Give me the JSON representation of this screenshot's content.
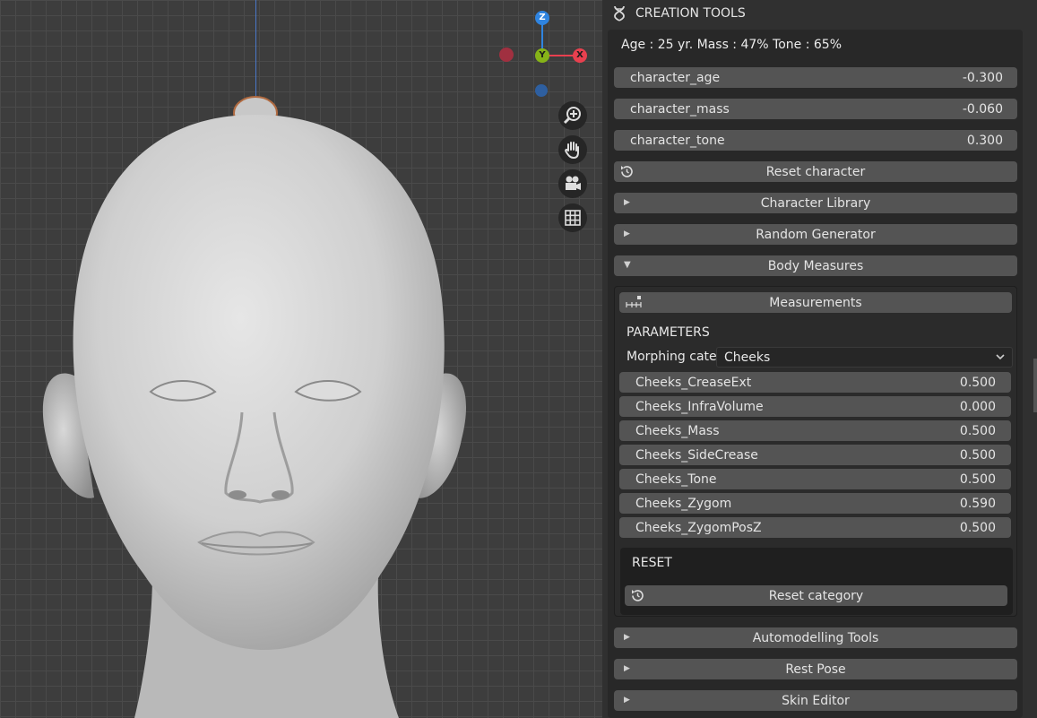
{
  "panel": {
    "title": "CREATION TOOLS",
    "status": "Age : 25 yr.  Mass : 47%  Tone : 65%",
    "fields": [
      {
        "label": "character_age",
        "value": "-0.300"
      },
      {
        "label": "character_mass",
        "value": "-0.060"
      },
      {
        "label": "character_tone",
        "value": "0.300"
      }
    ],
    "reset_character": "Reset character",
    "collapsed_sections": [
      "Character Library",
      "Random Generator"
    ],
    "body_measures": {
      "label": "Body Measures",
      "measurements": "Measurements",
      "parameters_heading": "PARAMETERS",
      "morphing_label": "Morphing cate..",
      "morphing_value": "Cheeks",
      "params": [
        {
          "label": "Cheeks_CreaseExt",
          "value": "0.500"
        },
        {
          "label": "Cheeks_InfraVolume",
          "value": "0.000"
        },
        {
          "label": "Cheeks_Mass",
          "value": "0.500"
        },
        {
          "label": "Cheeks_SideCrease",
          "value": "0.500"
        },
        {
          "label": "Cheeks_Tone",
          "value": "0.500"
        },
        {
          "label": "Cheeks_Zygom",
          "value": "0.590"
        },
        {
          "label": "Cheeks_ZygomPosZ",
          "value": "0.500"
        }
      ],
      "reset_heading": "RESET",
      "reset_category": "Reset category"
    },
    "bottom_sections": [
      "Automodelling Tools",
      "Rest Pose",
      "Skin Editor"
    ]
  },
  "gizmo": {
    "z": "Z",
    "y": "Y",
    "x": "X"
  },
  "viewport_tools": [
    "zoom-icon",
    "hand-icon",
    "camera-icon",
    "grid-icon"
  ],
  "colors": {
    "x_axis": "#e8404f",
    "y_axis": "#86b318",
    "z_axis": "#2f84e0",
    "button": "#545454",
    "panel": "#282828"
  }
}
